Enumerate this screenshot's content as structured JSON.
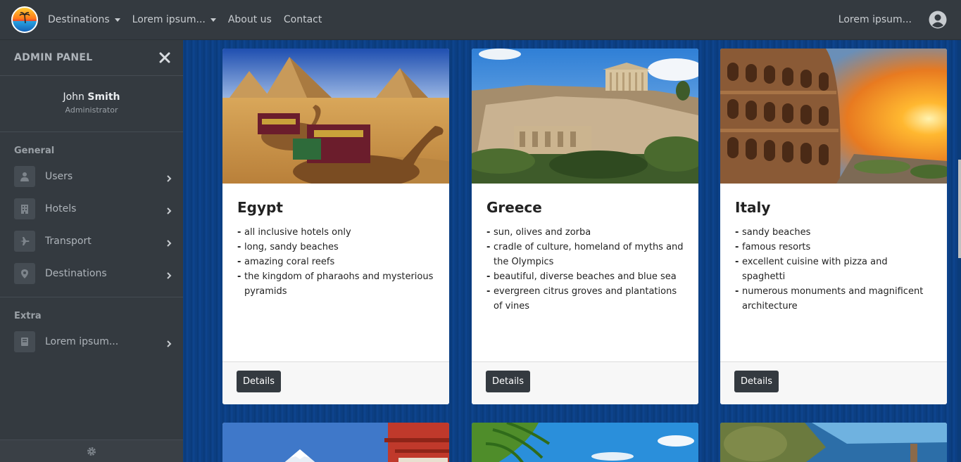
{
  "navbar": {
    "items": [
      {
        "label": "Destinations",
        "dropdown": true
      },
      {
        "label": "Lorem ipsum...",
        "dropdown": true
      },
      {
        "label": "About us",
        "dropdown": false
      },
      {
        "label": "Contact",
        "dropdown": false
      }
    ],
    "user_label": "Lorem ipsum..."
  },
  "sidebar": {
    "title": "ADMIN PANEL",
    "profile": {
      "first_name": "John",
      "last_name": "Smith",
      "role": "Administrator"
    },
    "sections": [
      {
        "title": "General",
        "items": [
          {
            "label": "Users",
            "icon": "user-icon"
          },
          {
            "label": "Hotels",
            "icon": "building-icon"
          },
          {
            "label": "Transport",
            "icon": "plane-icon"
          },
          {
            "label": "Destinations",
            "icon": "map-pin-icon"
          }
        ]
      },
      {
        "title": "Extra",
        "items": [
          {
            "label": "Lorem ipsum...",
            "icon": "book-icon"
          }
        ]
      }
    ]
  },
  "cards": [
    {
      "title": "Egypt",
      "features": [
        "all inclusive hotels only",
        "long, sandy beaches",
        "amazing coral reefs",
        "the kingdom of pharaohs and mysterious pyramids"
      ],
      "button": "Details"
    },
    {
      "title": "Greece",
      "features": [
        "sun, olives and zorba",
        "cradle of culture, homeland of myths and the Olympics",
        "beautiful, diverse beaches and blue sea",
        "evergreen citrus groves and plantations of vines"
      ],
      "button": "Details"
    },
    {
      "title": "Italy",
      "features": [
        "sandy beaches",
        "famous resorts",
        "excellent cuisine with pizza and spaghetti",
        "numerous monuments and magnificent architecture"
      ],
      "button": "Details"
    }
  ],
  "colors": {
    "navbar": "#343a40",
    "sidebar": "#343a40",
    "background": "#0b3c7a",
    "button": "#343a40"
  }
}
